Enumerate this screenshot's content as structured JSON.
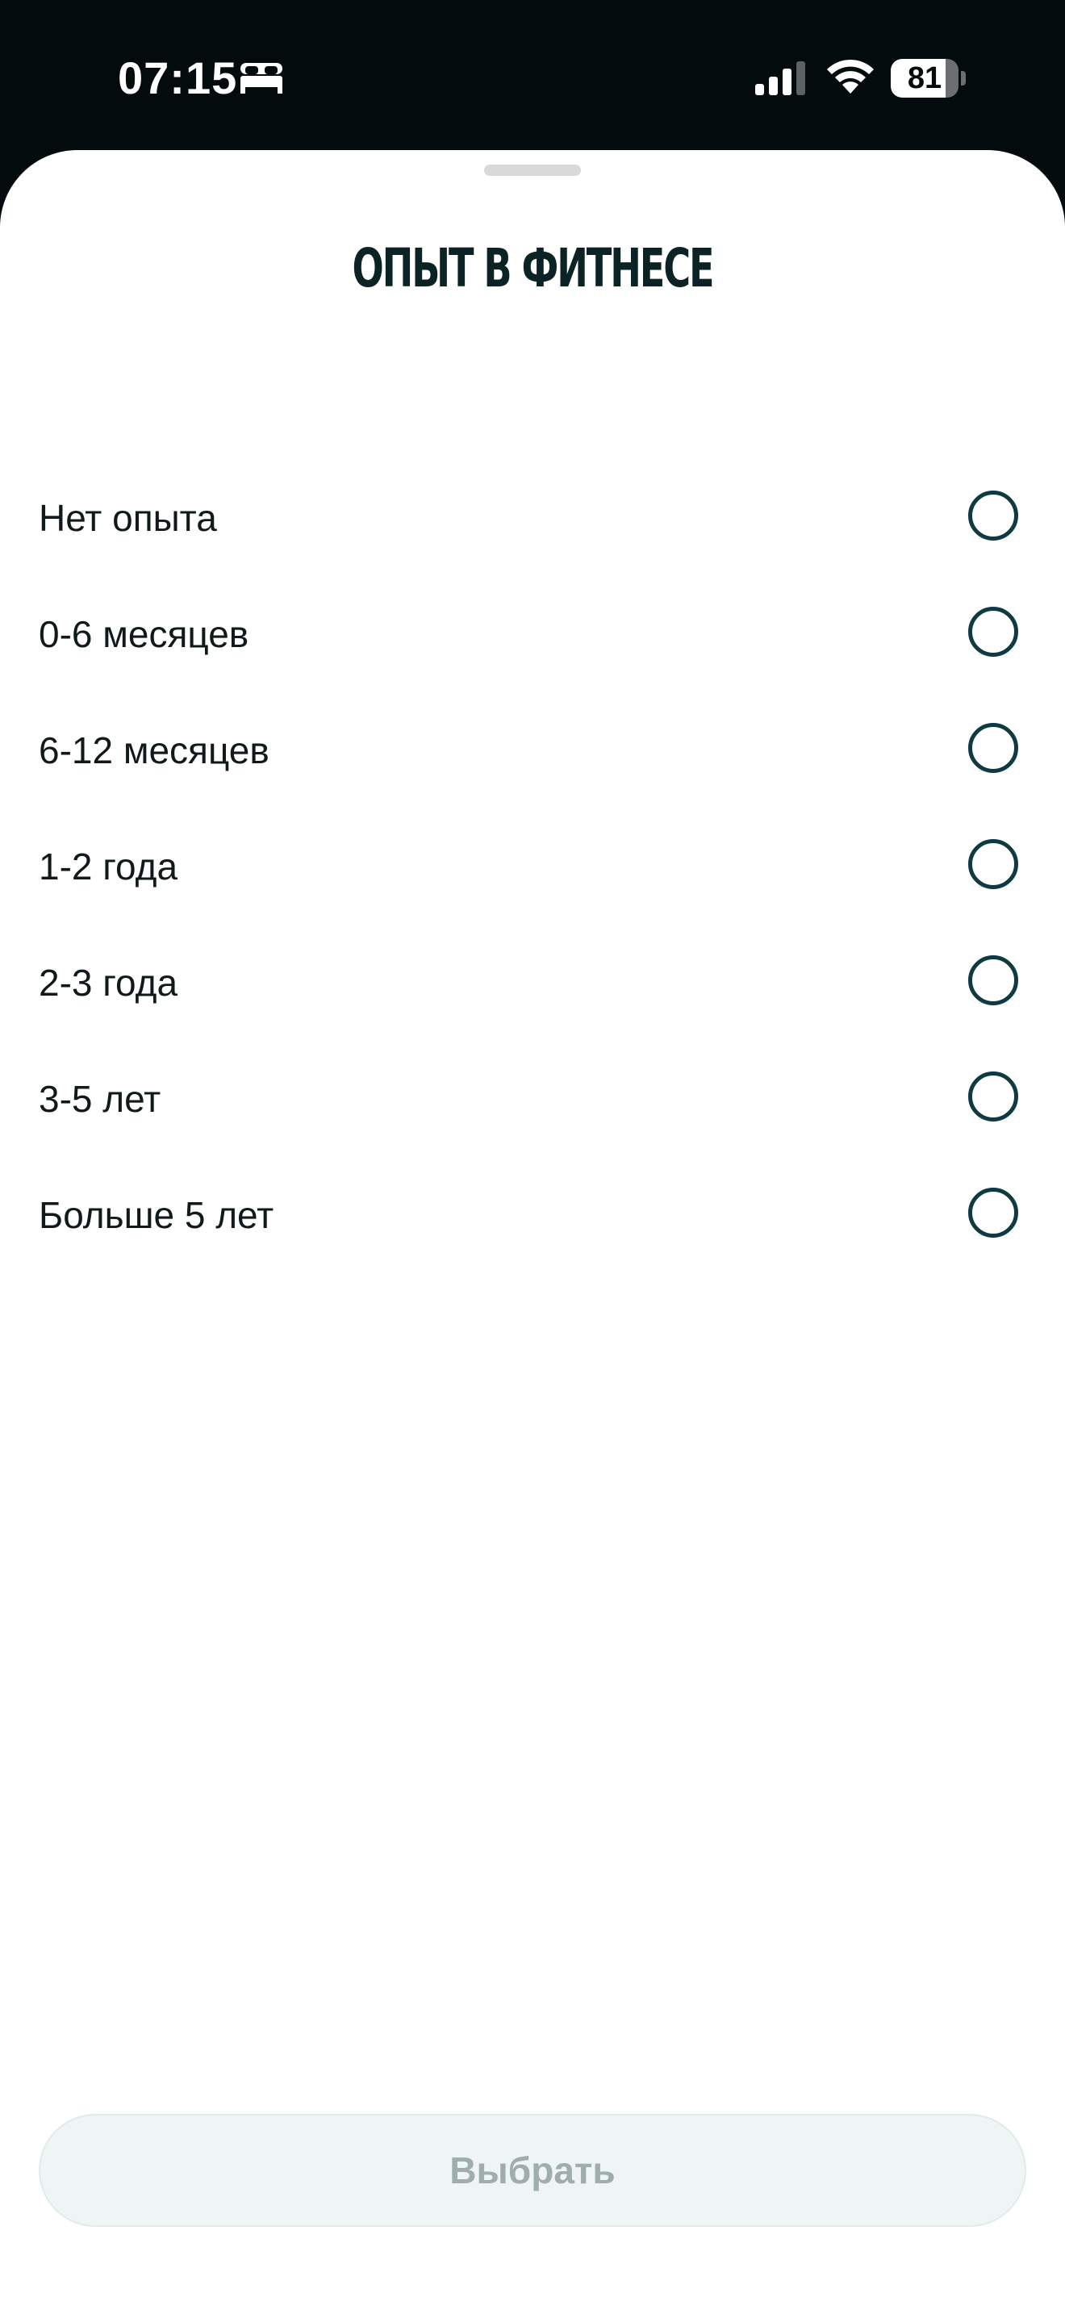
{
  "status_bar": {
    "time": "07:15",
    "battery_level": "81",
    "battery_fraction": 0.81,
    "icons": [
      "bed-icon",
      "cellular-signal-icon",
      "wifi-icon",
      "battery-icon"
    ]
  },
  "sheet": {
    "title": "ОПЫТ В ФИТНЕСЕ",
    "options": [
      {
        "label": "Нет опыта",
        "selected": false
      },
      {
        "label": "0-6 месяцев",
        "selected": false
      },
      {
        "label": "6-12 месяцев",
        "selected": false
      },
      {
        "label": "1-2 года",
        "selected": false
      },
      {
        "label": "2-3 года",
        "selected": false
      },
      {
        "label": "3-5 лет",
        "selected": false
      },
      {
        "label": "Больше 5 лет",
        "selected": false
      }
    ],
    "select_button_label": "Выбрать",
    "select_button_enabled": false
  },
  "colors": {
    "status_bar_bg": "#040b0c",
    "title_color": "#0c2326",
    "radio_border": "#0d3b41",
    "button_disabled_bg": "#eef5f4",
    "button_disabled_text": "#9fadab"
  }
}
